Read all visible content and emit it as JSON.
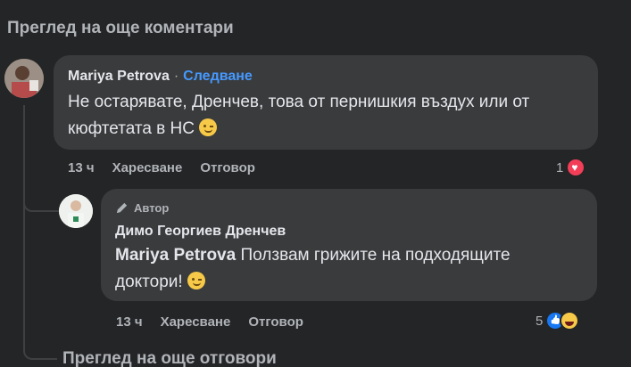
{
  "header": {
    "view_more_comments": "Преглед на още коментари"
  },
  "comment1": {
    "author": "Mariya Petrova",
    "separator": "·",
    "follow_label": "Следване",
    "text": "Не остарявате, Дренчев, това от пернишкия въздух или от кюфтетата в НС",
    "time": "13 ч",
    "like_label": "Харесване",
    "reply_label": "Отговор",
    "reaction_count": "1"
  },
  "reply1": {
    "badge": "Автор",
    "author": "Димо Георгиев Дренчев",
    "mention": "Mariya Petrova",
    "text": "Ползвам грижите на подходящите доктори!",
    "time": "13 ч",
    "like_label": "Харесване",
    "reply_label": "Отговор",
    "reaction_count": "5"
  },
  "footer": {
    "view_more_replies": "Преглед на още отговори"
  }
}
